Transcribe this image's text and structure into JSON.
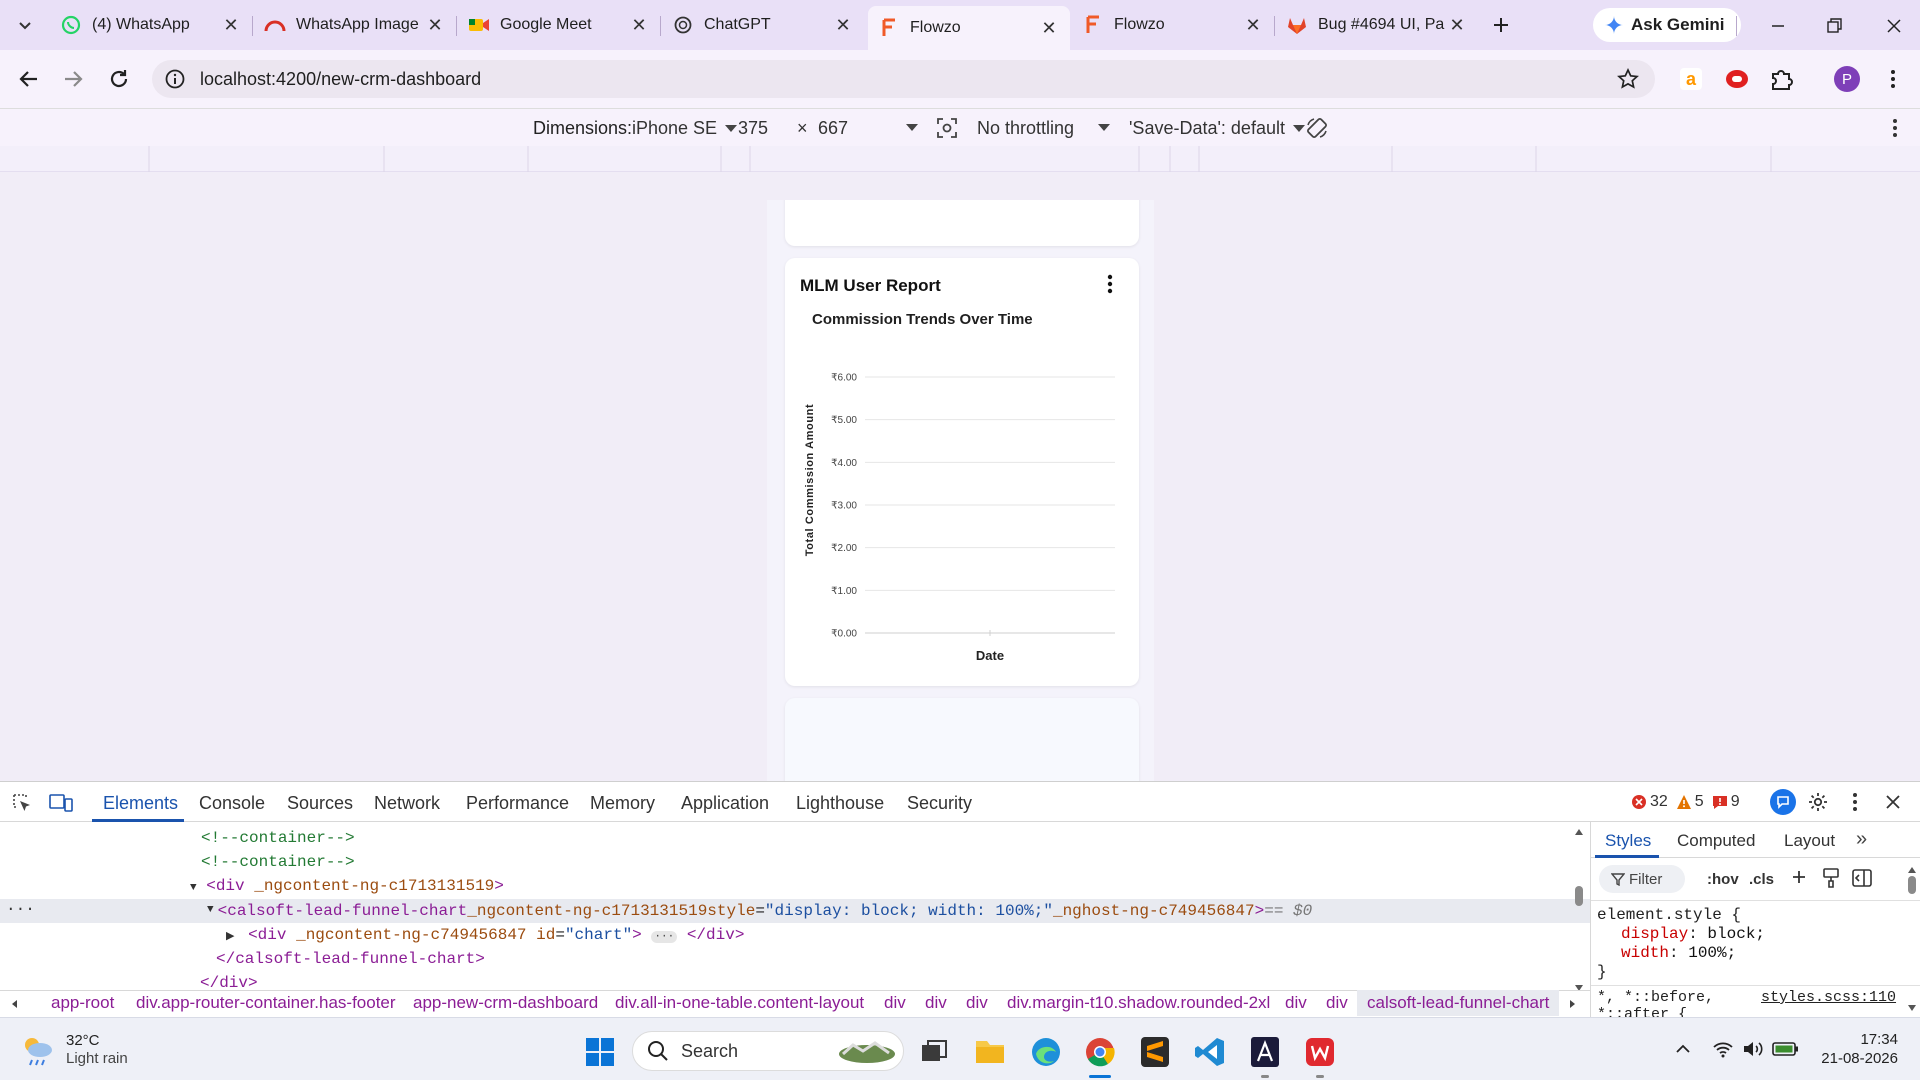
{
  "browser": {
    "tabs": [
      {
        "title": "(4) WhatsApp",
        "icon": "whatsapp-icon"
      },
      {
        "title": "WhatsApp Image",
        "icon": "whatsapp-image-icon"
      },
      {
        "title": "Google Meet",
        "icon": "google-meet-icon"
      },
      {
        "title": "ChatGPT",
        "icon": "chatgpt-icon"
      },
      {
        "title": "Flowzo",
        "icon": "flowzo-icon",
        "active": true
      },
      {
        "title": "Flowzo",
        "icon": "flowzo-icon"
      },
      {
        "title": "Bug #4694 UI, Pa",
        "icon": "gitlab-icon"
      }
    ],
    "ask_gemini": "Ask Gemini",
    "url": "localhost:4200/new-crm-dashboard",
    "profile_initial": "P"
  },
  "device_toolbar": {
    "dimensions_label": "Dimensions:",
    "device": "iPhone SE",
    "width": "375",
    "times": "×",
    "height": "667",
    "throttling": "No throttling",
    "save_data": "'Save-Data': default"
  },
  "card": {
    "title": "MLM User Report"
  },
  "chart_data": {
    "type": "line",
    "title": "Commission Trends Over Time",
    "xlabel": "Date",
    "ylabel": "Total Commission Amount",
    "y_ticks": [
      "₹0.00",
      "₹1.00",
      "₹2.00",
      "₹3.00",
      "₹4.00",
      "₹5.00",
      "₹6.00"
    ],
    "ylim": [
      0,
      6
    ],
    "categories": [],
    "series": [],
    "grid": true
  },
  "devtools": {
    "tabs": [
      "Elements",
      "Console",
      "Sources",
      "Network",
      "Performance",
      "Memory",
      "Application",
      "Lighthouse",
      "Security"
    ],
    "errors": "32",
    "warnings": "5",
    "issues": "9",
    "code": {
      "line1": "<!--container-->",
      "line2": "<!--container-->",
      "line3_tag": "<div",
      "line3_attr": " _ngcontent-ng-c1713131519",
      "line3_end": ">",
      "line4_tag": "<calsoft-lead-funnel-chart",
      "line4_attr1": " _ngcontent-ng-c1713131519",
      "line4_attr2": " style",
      "line4_eq": "=",
      "line4_val": "\"display: block; width: 100%;\"",
      "line4_attr3": " _nghost-ng-c749456847",
      "line4_end": ">",
      "line4_sel": " == $0",
      "line5_tag": "<div",
      "line5_attr1": " _ngcontent-ng-c749456847",
      "line5_attr2": " id",
      "line5_eq": "=",
      "line5_val": "\"chart\"",
      "line5_end": ">",
      "line5_ellipsis": "···",
      "line5_close": "</div>",
      "line6": "</calsoft-lead-funnel-chart>",
      "line7": "</div>"
    },
    "breadcrumbs": [
      "app-root",
      "div.app-router-container.has-footer",
      "app-new-crm-dashboard",
      "div.all-in-one-table.content-layout",
      "div",
      "div",
      "div",
      "div.margin-t10.shadow.rounded-2xl",
      "div",
      "div",
      "calsoft-lead-funnel-chart"
    ],
    "styles_tabs": [
      "Styles",
      "Computed",
      "Layout"
    ],
    "filter_placeholder": "Filter",
    "hov": ":hov",
    "cls": ".cls",
    "style_rule": {
      "selector": "element.style {",
      "decl1_prop": "display",
      "decl1_val": "block;",
      "decl2_prop": "width",
      "decl2_val": "100%;",
      "close": "}",
      "next_selector": "*, *::before,",
      "next_selector2": "*::after {",
      "next_source": "styles.scss:110"
    }
  },
  "taskbar": {
    "temperature": "32°C",
    "weather": "Light rain",
    "search": "Search",
    "time": "17:34",
    "date": "21-08-2026"
  }
}
